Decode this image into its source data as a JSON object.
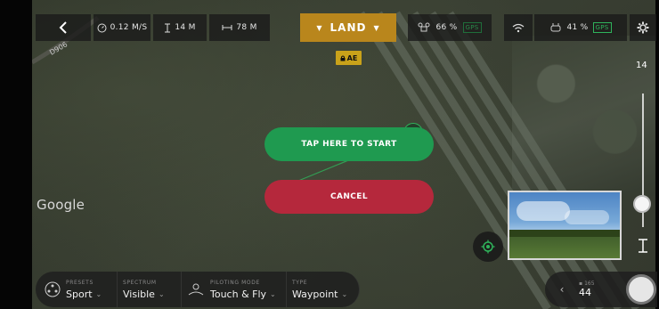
{
  "topbar": {
    "speed": "0.12 M/S",
    "altitude": "14 M",
    "distance": "78 M",
    "land_label": "LAND",
    "drone_battery": "66 %",
    "drone_gps": "GPS",
    "controller_battery": "41 %",
    "controller_gps": "GPS"
  },
  "map": {
    "road_label": "D906",
    "provider": "Google"
  },
  "ae_badge": "AE",
  "actions": {
    "start_label": "TAP HERE TO START",
    "cancel_label": "CANCEL"
  },
  "altitude_slider": {
    "value_label": "14",
    "level_fraction": 0.21
  },
  "bottombar": {
    "presets": {
      "title": "PRESETS",
      "value": "Sport"
    },
    "spectrum": {
      "title": "SPECTRUM",
      "value": "Visible"
    },
    "piloting_mode": {
      "title": "PILOTING MODE",
      "value": "Touch & Fly"
    },
    "type": {
      "title": "TYPE",
      "value": "Waypoint"
    }
  },
  "media": {
    "total": "165",
    "current": "44"
  },
  "colors": {
    "land": "#b9861c",
    "start": "#1f9a50",
    "cancel": "#b5283c",
    "gps": "#2fb35b"
  },
  "icons": {
    "back": "chevron-left-icon",
    "speed": "speedometer-icon",
    "altitude": "altitude-icon",
    "distance": "distance-icon",
    "drone": "drone-icon",
    "wifi": "wifi-icon",
    "controller": "controller-icon",
    "settings": "gear-icon",
    "home": "home-icon",
    "recenter": "recenter-icon"
  }
}
